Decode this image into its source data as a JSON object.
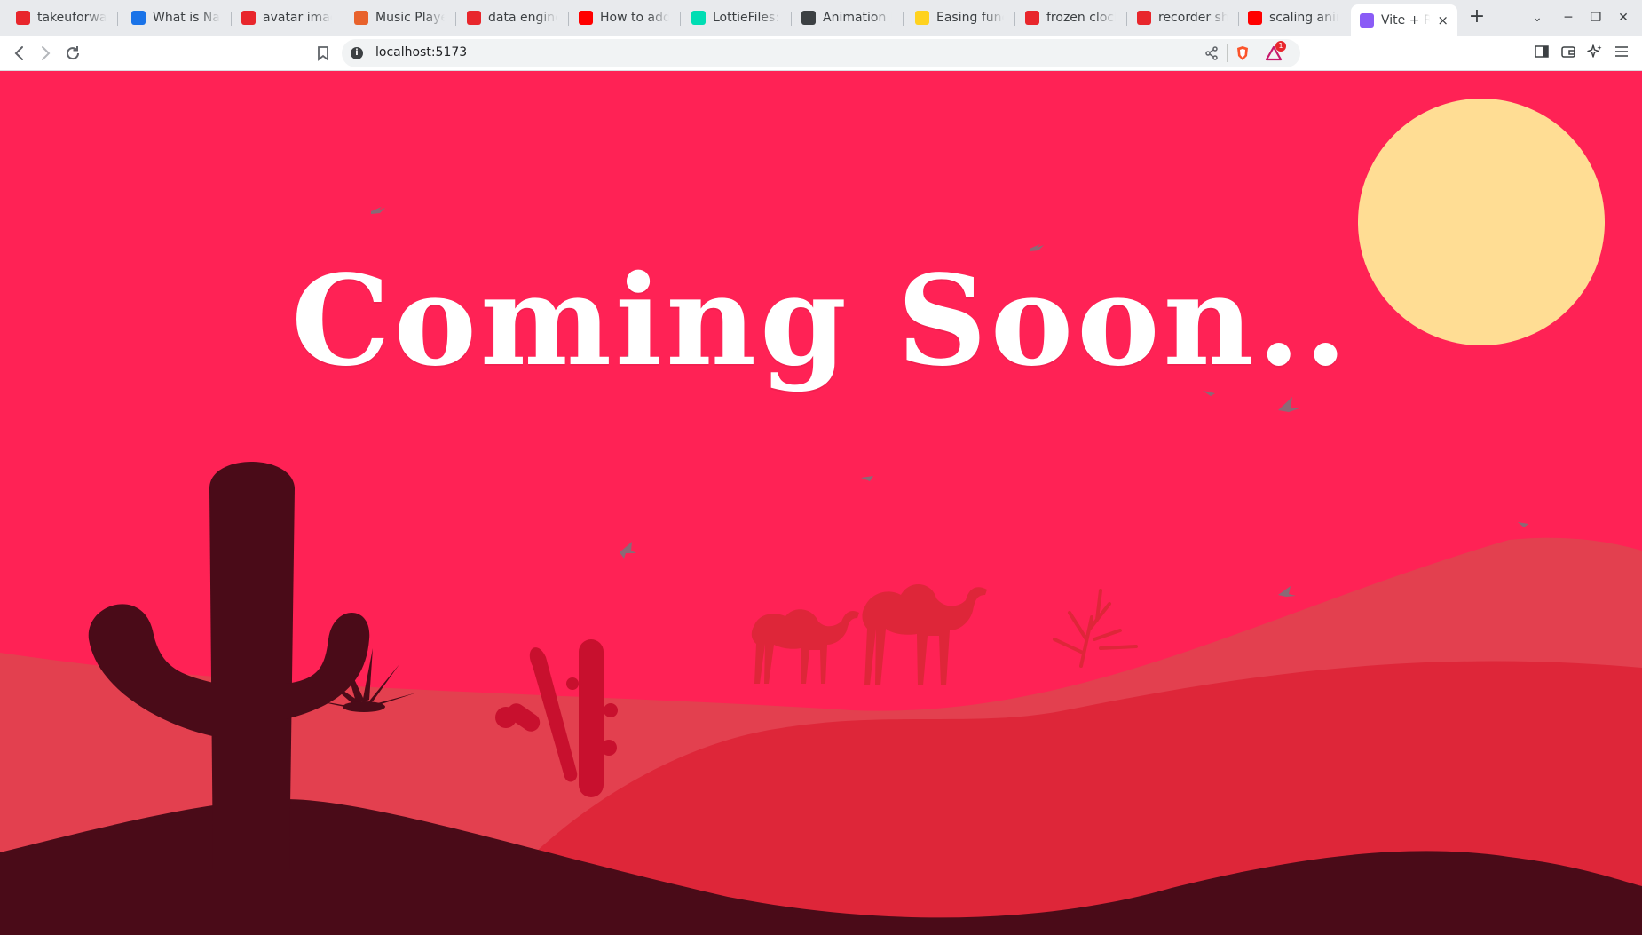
{
  "browser": {
    "tabs": [
      {
        "title": "takeuforwa",
        "favicon": "tuf-icon",
        "color": "#e8262c"
      },
      {
        "title": "What is Nat",
        "favicon": "chart-trend-icon",
        "color": "#1a73e8"
      },
      {
        "title": "avatar imag",
        "favicon": "shield-icon",
        "color": "#e8262c"
      },
      {
        "title": "Music Playe",
        "favicon": "asterisk-icon",
        "color": "#e8622c"
      },
      {
        "title": "data engine",
        "favicon": "shield-icon",
        "color": "#e8262c"
      },
      {
        "title": "How to add",
        "favicon": "youtube-icon",
        "color": "#ff0000"
      },
      {
        "title": "LottieFiles:",
        "favicon": "lottie-icon",
        "color": "#00ddb3"
      },
      {
        "title": "Animation |",
        "favicon": "openai-icon",
        "color": "#3c4043"
      },
      {
        "title": "Easing func",
        "favicon": "easing-icon",
        "color": "#ffd21f"
      },
      {
        "title": "frozen clock",
        "favicon": "shield-icon",
        "color": "#e8262c"
      },
      {
        "title": "recorder sh",
        "favicon": "shield-icon",
        "color": "#e8262c"
      },
      {
        "title": "scaling anim",
        "favicon": "youtube-icon",
        "color": "#ff0000"
      },
      {
        "title": "Vite + R",
        "favicon": "vite-icon",
        "color": "#8a5cf6",
        "active": true
      }
    ],
    "new_tab_label": "+",
    "close_tab_label": "×",
    "url": "localhost:5173",
    "notification_badge": "1"
  },
  "page": {
    "headline": "Coming Soon..",
    "colors": {
      "sky": "#ff2255",
      "sun": "#ffdd94",
      "dune_back": "#e3404f",
      "dune_mid": "#de2639",
      "dune_front": "#4a0b18",
      "camel": "#de2639",
      "cactus_small": "#c8102e",
      "bird": "#8a6a76"
    }
  }
}
